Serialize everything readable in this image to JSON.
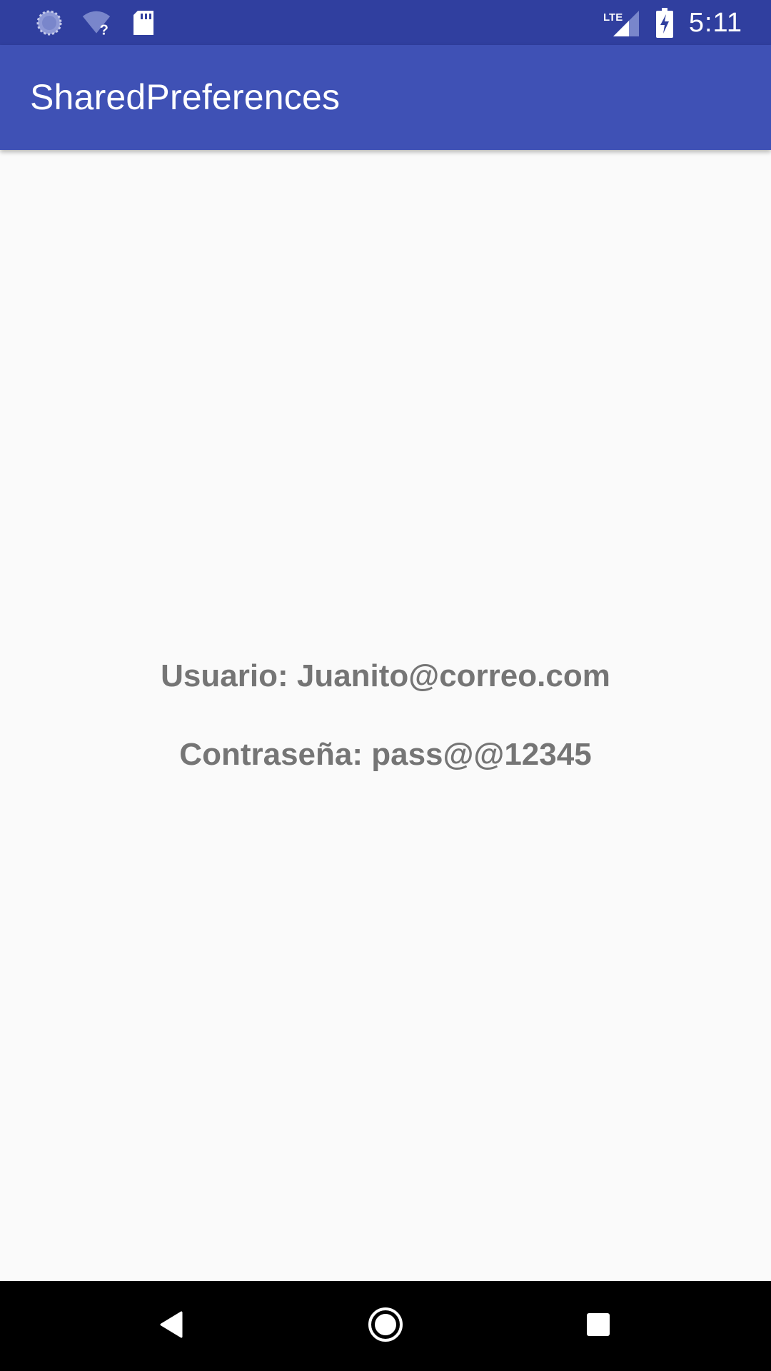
{
  "status_bar": {
    "time": "5:11",
    "network_label": "LTE",
    "icons": [
      "sync-icon",
      "wifi-unknown-icon",
      "sd-card-icon",
      "lte-signal-icon",
      "battery-charging-icon"
    ]
  },
  "app_bar": {
    "title": "SharedPreferences"
  },
  "content": {
    "user_line": "Usuario: Juanito@correo.com",
    "password_line": "Contraseña: pass@@12345"
  },
  "nav_bar": {
    "buttons": [
      "back-icon",
      "home-icon",
      "recents-icon"
    ]
  },
  "colors": {
    "status_bar": "#303f9f",
    "app_bar": "#3f51b5",
    "background": "#fafafa",
    "text": "#757575",
    "nav_bar": "#000000"
  }
}
